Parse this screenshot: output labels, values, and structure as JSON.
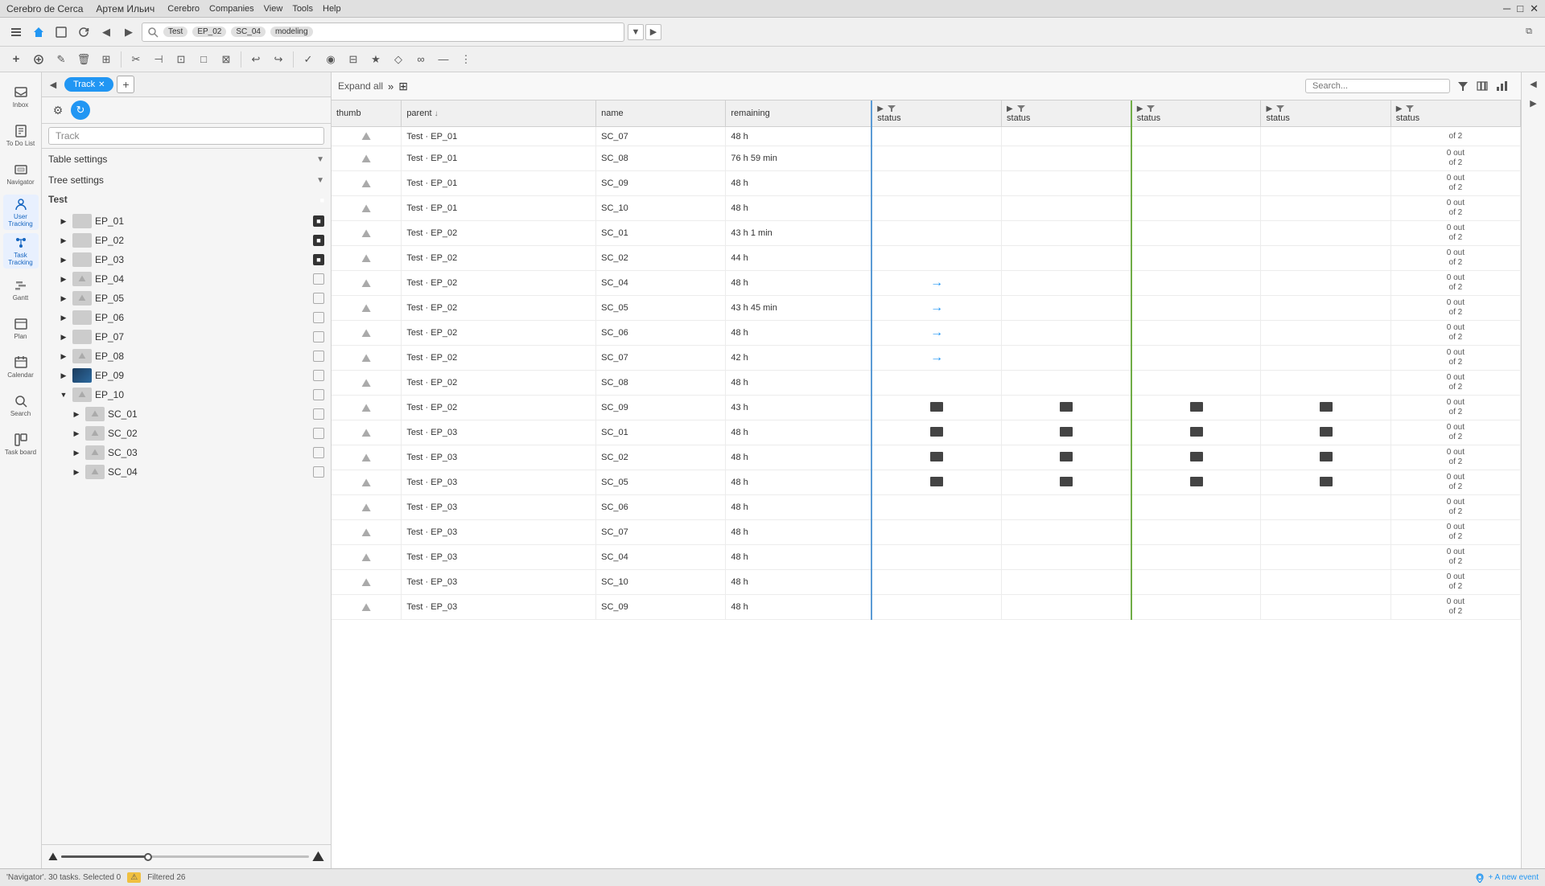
{
  "titlebar": {
    "appname": "Cerebro de Cerca",
    "username": "Артем Ильич",
    "menus": [
      "Cerebro",
      "Companies",
      "View",
      "Tools",
      "Help"
    ],
    "controls": [
      "─",
      "□",
      "✕"
    ]
  },
  "toolbar1": {
    "search_tags": [
      "Test",
      "EP_02",
      "SC_04",
      "modeling"
    ],
    "nav_back": "◀",
    "nav_forward": "▶"
  },
  "toolbar2": {
    "buttons": [
      "+",
      "⊕",
      "✎",
      "🗑",
      "⊞",
      "✂",
      "⊣",
      "⊡",
      "□",
      "⊠",
      "⊢",
      "↩",
      "↪",
      "✓",
      "◉",
      "⊟",
      "★",
      "◇",
      "⊡",
      "⊠",
      "∞",
      "—",
      "⋮"
    ]
  },
  "panel": {
    "add_button": "+",
    "settings_icon": "⚙",
    "blue_circle": "↻",
    "tab_track": "Track",
    "search_placeholder": "Track",
    "table_settings": "Table settings",
    "tree_settings": "Tree settings",
    "collapse_left": "◀",
    "collapse_right": "▶"
  },
  "tree": {
    "root": "Test",
    "items": [
      {
        "id": "EP_01",
        "indent": 1,
        "has_thumb": true,
        "thumb_type": "img1",
        "checked": true,
        "expanded": false
      },
      {
        "id": "EP_02",
        "indent": 1,
        "has_thumb": true,
        "thumb_type": "img2",
        "checked": true,
        "expanded": false
      },
      {
        "id": "EP_03",
        "indent": 1,
        "has_thumb": true,
        "thumb_type": "img3",
        "checked": true,
        "expanded": false
      },
      {
        "id": "EP_04",
        "indent": 1,
        "has_thumb": false,
        "thumb_type": "mountain",
        "checked": false,
        "expanded": false
      },
      {
        "id": "EP_05",
        "indent": 1,
        "has_thumb": false,
        "thumb_type": "mountain",
        "checked": false,
        "expanded": false
      },
      {
        "id": "EP_06",
        "indent": 1,
        "has_thumb": false,
        "thumb_type": "none",
        "checked": false,
        "expanded": false
      },
      {
        "id": "EP_07",
        "indent": 1,
        "has_thumb": true,
        "thumb_type": "img4",
        "checked": false,
        "expanded": false
      },
      {
        "id": "EP_08",
        "indent": 1,
        "has_thumb": false,
        "thumb_type": "mountain",
        "checked": false,
        "expanded": false
      },
      {
        "id": "EP_09",
        "indent": 1,
        "has_thumb": true,
        "thumb_type": "img5",
        "checked": false,
        "expanded": false
      },
      {
        "id": "EP_10",
        "indent": 1,
        "has_thumb": false,
        "thumb_type": "mountain",
        "checked": false,
        "expanded": true
      },
      {
        "id": "SC_01",
        "indent": 2,
        "has_thumb": false,
        "thumb_type": "mountain",
        "checked": false,
        "expanded": false
      },
      {
        "id": "SC_02",
        "indent": 2,
        "has_thumb": false,
        "thumb_type": "mountain",
        "checked": false,
        "expanded": false
      },
      {
        "id": "SC_03",
        "indent": 2,
        "has_thumb": false,
        "thumb_type": "mountain",
        "checked": false,
        "expanded": false
      },
      {
        "id": "SC_04",
        "indent": 2,
        "has_thumb": false,
        "thumb_type": "mountain",
        "checked": false,
        "expanded": false
      }
    ]
  },
  "table": {
    "toolbar": {
      "expand_all": "Expand all",
      "expand_icon": "»",
      "grid_icon": "⊞"
    },
    "columns": {
      "thumb": "thumb",
      "parent": "parent",
      "sort_icon": "↓",
      "name": "name",
      "remaining": "remaining",
      "status1": "status",
      "status2": "status",
      "status3": "status",
      "status4": "status",
      "status5": "status"
    },
    "rows": [
      {
        "parent": "Test · EP_01",
        "name": "SC_07",
        "remaining": "48 h",
        "s1": "",
        "s2": "",
        "s3": "",
        "s4": "",
        "s5": "of 2",
        "s5_top": ""
      },
      {
        "parent": "Test · EP_01",
        "name": "SC_08",
        "remaining": "76 h 59 min",
        "s1": "",
        "s2": "",
        "s3": "",
        "s4": "",
        "s5_count": "0 out",
        "s5_of": "of 2"
      },
      {
        "parent": "Test · EP_01",
        "name": "SC_09",
        "remaining": "48 h",
        "s1": "",
        "s2": "",
        "s3": "",
        "s4": "",
        "s5_count": "0 out",
        "s5_of": "of 2"
      },
      {
        "parent": "Test · EP_01",
        "name": "SC_10",
        "remaining": "48 h",
        "s1": "",
        "s2": "",
        "s3": "",
        "s4": "",
        "s5_count": "0 out",
        "s5_of": "of 2"
      },
      {
        "parent": "Test · EP_02",
        "name": "SC_01",
        "remaining": "43 h 1 min",
        "s1": "",
        "s2": "",
        "s3": "",
        "s4": "",
        "s5_count": "0 out",
        "s5_of": "of 2"
      },
      {
        "parent": "Test · EP_02",
        "name": "SC_02",
        "remaining": "44 h",
        "s1": "",
        "s2": "",
        "s3": "",
        "s4": "",
        "s5_count": "0 out",
        "s5_of": "of 2"
      },
      {
        "parent": "Test · EP_02",
        "name": "SC_04",
        "remaining": "48 h",
        "s1": "→",
        "s2": "",
        "s3": "",
        "s4": "",
        "s5_count": "0 out",
        "s5_of": "of 2"
      },
      {
        "parent": "Test · EP_02",
        "name": "SC_05",
        "remaining": "43 h 45 min",
        "s1": "→",
        "s2": "",
        "s3": "",
        "s4": "",
        "s5_count": "0 out",
        "s5_of": "of 2"
      },
      {
        "parent": "Test · EP_02",
        "name": "SC_06",
        "remaining": "48 h",
        "s1": "→",
        "s2": "",
        "s3": "",
        "s4": "",
        "s5_count": "0 out",
        "s5_of": "of 2"
      },
      {
        "parent": "Test · EP_02",
        "name": "SC_07",
        "remaining": "42 h",
        "s1": "→",
        "s2": "",
        "s3": "",
        "s4": "",
        "s5_count": "0 out",
        "s5_of": "of 2"
      },
      {
        "parent": "Test · EP_02",
        "name": "SC_08",
        "remaining": "48 h",
        "s1": "",
        "s2": "",
        "s3": "",
        "s4": "",
        "s5_count": "0 out",
        "s5_of": "of 2"
      },
      {
        "parent": "Test · EP_02",
        "name": "SC_09",
        "remaining": "43 h",
        "s1": "■",
        "s2": "■",
        "s3": "■",
        "s4": "■",
        "s5_count": "0 out",
        "s5_of": "of 2"
      },
      {
        "parent": "Test · EP_03",
        "name": "SC_01",
        "remaining": "48 h",
        "s1": "■",
        "s2": "■",
        "s3": "■",
        "s4": "■",
        "s5_count": "0 out",
        "s5_of": "of 2"
      },
      {
        "parent": "Test · EP_03",
        "name": "SC_02",
        "remaining": "48 h",
        "s1": "■",
        "s2": "■",
        "s3": "■",
        "s4": "■",
        "s5_count": "0 out",
        "s5_of": "of 2"
      },
      {
        "parent": "Test · EP_03",
        "name": "SC_05",
        "remaining": "48 h",
        "s1": "■",
        "s2": "■",
        "s3": "■",
        "s4": "■",
        "s5_count": "0 out",
        "s5_of": "of 2"
      },
      {
        "parent": "Test · EP_03",
        "name": "SC_06",
        "remaining": "48 h",
        "s1": "",
        "s2": "",
        "s3": "",
        "s4": "",
        "s5_count": "0 out",
        "s5_of": "of 2"
      },
      {
        "parent": "Test · EP_03",
        "name": "SC_07",
        "remaining": "48 h",
        "s1": "",
        "s2": "",
        "s3": "",
        "s4": "",
        "s5_count": "0 out",
        "s5_of": "of 2"
      },
      {
        "parent": "Test · EP_03",
        "name": "SC_04",
        "remaining": "48 h",
        "s1": "",
        "s2": "",
        "s3": "",
        "s4": "",
        "s5_count": "0 out",
        "s5_of": "of 2"
      },
      {
        "parent": "Test · EP_03",
        "name": "SC_10",
        "remaining": "48 h",
        "s1": "",
        "s2": "",
        "s3": "",
        "s4": "",
        "s5_count": "0 out",
        "s5_of": "of 2"
      },
      {
        "parent": "Test · EP_03",
        "name": "SC_09",
        "remaining": "48 h",
        "s1": "",
        "s2": "",
        "s3": "",
        "s4": "",
        "s5_count": "0 out",
        "s5_of": "of 2"
      }
    ]
  },
  "top_right": {
    "search_placeholder": "Search...",
    "filter_icon": "▼",
    "grid_icon": "⊞",
    "chart_icon": "▦"
  },
  "right_panel": {
    "nav_back": "◀",
    "nav_forward": "▶",
    "scroll_icon": "⋮"
  },
  "bottom_bar": {
    "status": "'Navigator'. 30 tasks. Selected 0",
    "filter": "Filtered 26",
    "event_button": "+ A new event"
  },
  "sidebar": {
    "items": [
      {
        "id": "inbox",
        "label": "Inbox",
        "icon": "inbox"
      },
      {
        "id": "todo",
        "label": "To Do List",
        "icon": "todo"
      },
      {
        "id": "navigator",
        "label": "Navigator",
        "icon": "navigator"
      },
      {
        "id": "user-tracking",
        "label": "User Tracking",
        "icon": "user-tracking"
      },
      {
        "id": "task-tracking",
        "label": "Task Tracking",
        "icon": "task-tracking"
      },
      {
        "id": "gantt",
        "label": "Gantt",
        "icon": "gantt"
      },
      {
        "id": "plan",
        "label": "Plan",
        "icon": "plan"
      },
      {
        "id": "calendar",
        "label": "Calendar",
        "icon": "calendar"
      },
      {
        "id": "search",
        "label": "Search",
        "icon": "search"
      },
      {
        "id": "taskboard",
        "label": "Task board",
        "icon": "taskboard"
      }
    ]
  }
}
